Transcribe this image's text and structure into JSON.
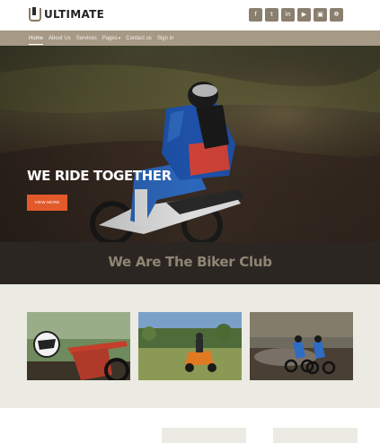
{
  "brand": {
    "name": "ULTIMATE"
  },
  "social": {
    "icons": [
      "facebook-icon",
      "twitter-icon",
      "linkedin-icon",
      "youtube-icon",
      "instagram-icon",
      "github-icon"
    ],
    "glyphs": [
      "f",
      "t",
      "in",
      "▶",
      "▣",
      "❁"
    ]
  },
  "nav": {
    "items": [
      {
        "label": "Home",
        "active": true
      },
      {
        "label": "About Us",
        "active": false
      },
      {
        "label": "Services",
        "active": false
      },
      {
        "label": "Pages",
        "active": false,
        "dropdown": true
      },
      {
        "label": "Contact us",
        "active": false
      },
      {
        "label": "Sign in",
        "active": false
      }
    ],
    "caret": "▾"
  },
  "hero": {
    "title": "WE RIDE TOGETHER",
    "button_label": "VIEW MORE"
  },
  "band": {
    "title": "We Are The Biker Club"
  },
  "colors": {
    "accent": "#e25a2c",
    "nav_bg": "#a69a86",
    "band_bg": "#2b2622",
    "band_text": "#8f8574",
    "gallery_bg": "#ecebe3"
  }
}
